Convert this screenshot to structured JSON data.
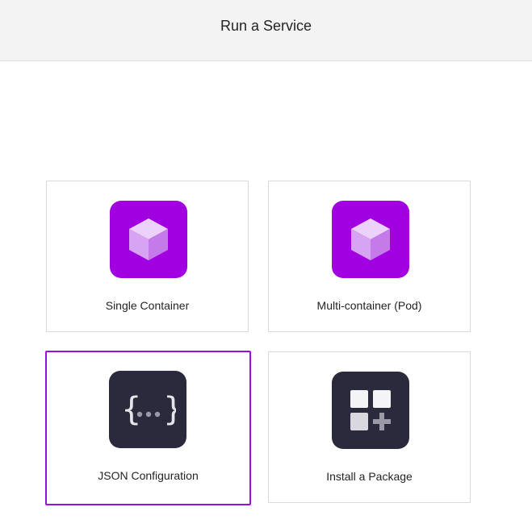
{
  "header": {
    "title": "Run a Service"
  },
  "options": [
    {
      "label": "Single Container",
      "icon": "container-cube-icon",
      "tile_color": "#a100e0"
    },
    {
      "label": "Multi-container (Pod)",
      "icon": "pod-cube-icon",
      "tile_color": "#a100e0"
    },
    {
      "label": "JSON Configuration",
      "icon": "json-braces-icon",
      "tile_color": "#2b2a3c",
      "selected": true
    },
    {
      "label": "Install a Package",
      "icon": "package-grid-plus-icon",
      "tile_color": "#2b2a3c"
    }
  ],
  "colors": {
    "accent": "#9a10d9",
    "header_bg": "#f3f3f3"
  }
}
